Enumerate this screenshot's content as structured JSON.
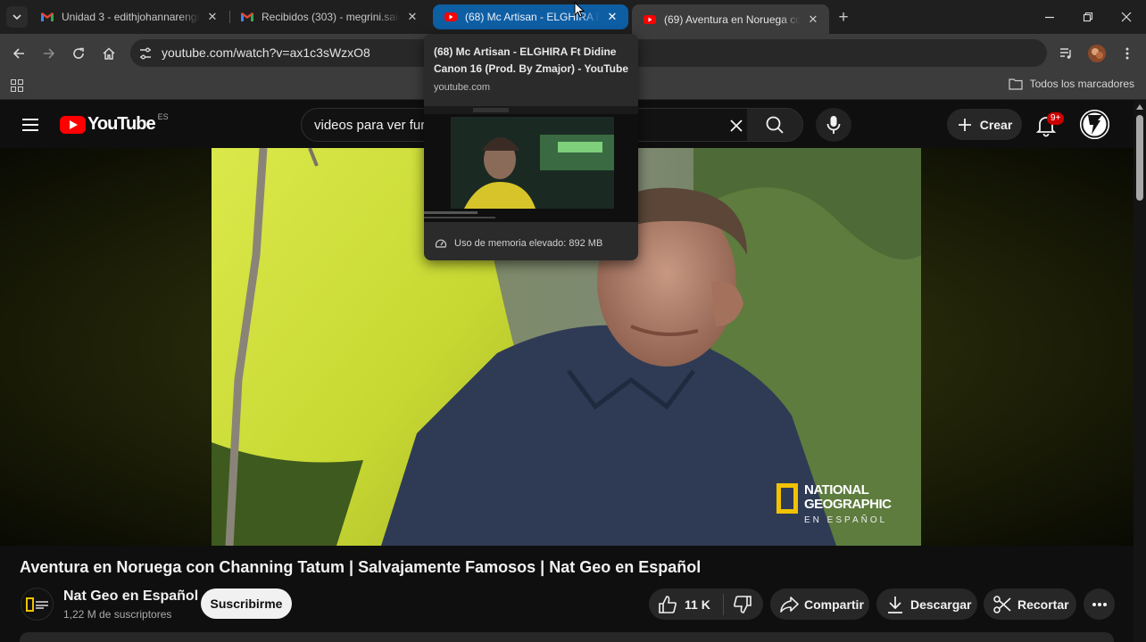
{
  "browser": {
    "tabs": [
      {
        "title": "Unidad 3 - edithjohannarengifo",
        "favicon": "gmail-icon"
      },
      {
        "title": "Recibidos (303) - megrini.saidi",
        "favicon": "gmail-icon"
      },
      {
        "title": "(68) Mc Artisan - ELGHIRA Ft Di",
        "favicon": "youtube-icon"
      },
      {
        "title": "(69) Aventura en Noruega con C",
        "favicon": "youtube-icon"
      }
    ],
    "url": "youtube.com/watch?v=ax1c3sWzxO8",
    "bookmarks_folder": "Todos los marcadores"
  },
  "hover_card": {
    "title": "(68) Mc Artisan - ELGHIRA Ft Didine Canon 16 (Prod. By Zmajor) - YouTube",
    "domain": "youtube.com",
    "memory": "Uso de memoria elevado: 892 MB"
  },
  "youtube": {
    "logo": "YouTube",
    "country": "ES",
    "search_query": "videos para ver fur",
    "create_label": "Crear",
    "notifications_badge": "9+",
    "video": {
      "title": "Aventura en Noruega con Channing Tatum | Salvajamente Famosos | Nat Geo en Español",
      "watermark_line1": "NATIONAL",
      "watermark_line2": "GEOGRAPHIC",
      "watermark_line3": "EN ESPAÑOL"
    },
    "channel": {
      "name": "Nat Geo en Español",
      "subscribers": "1,22 M de suscriptores",
      "subscribe_label": "Suscribirme"
    },
    "actions": {
      "likes": "11 K",
      "share": "Compartir",
      "download": "Descargar",
      "clip": "Recortar"
    }
  },
  "colors": {
    "youtube_red": "#ff0000",
    "tab_hover_blue": "#0e5ea4",
    "natgeo_yellow": "#f2c200",
    "badge_red": "#cc0000"
  }
}
